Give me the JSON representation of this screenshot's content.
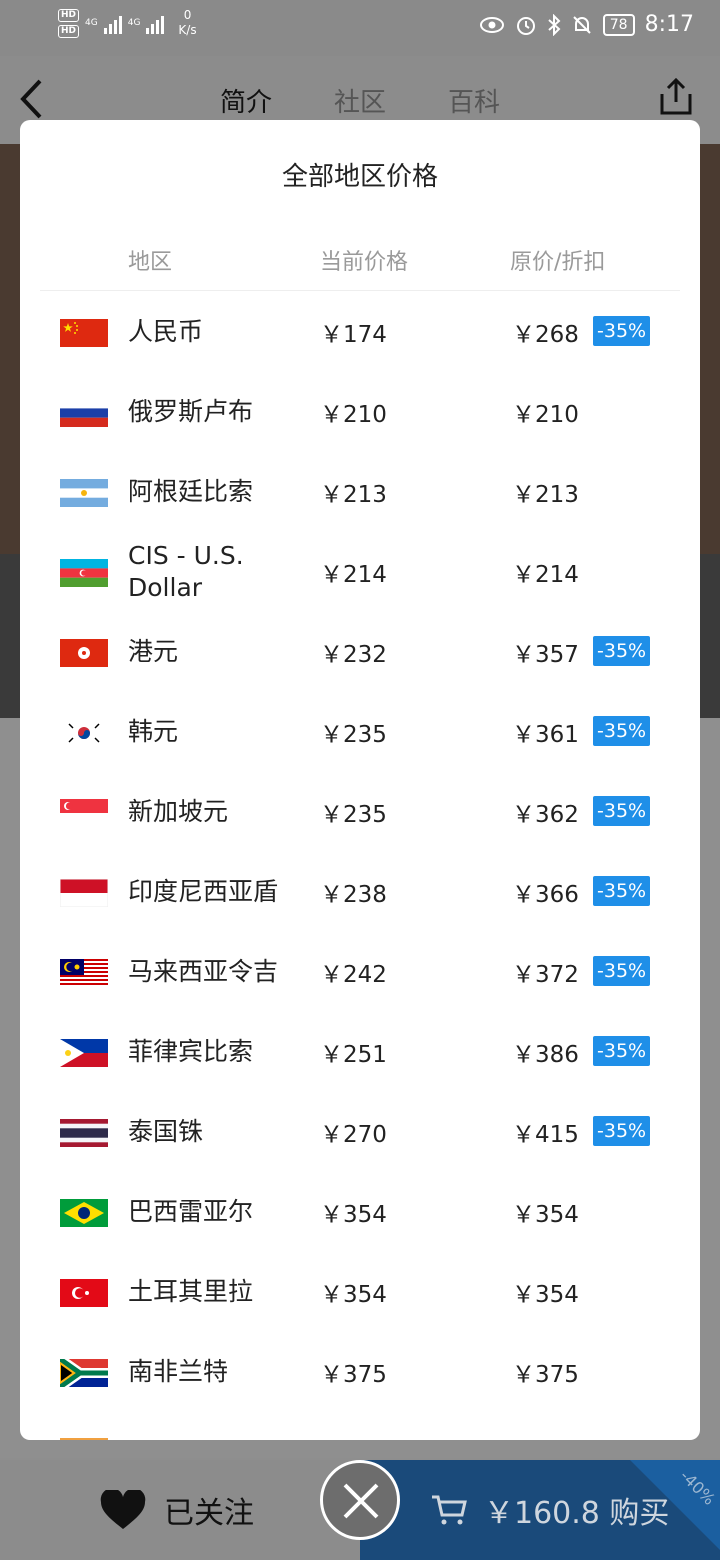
{
  "status_bar": {
    "speed_value": "0",
    "speed_unit": "K/s",
    "battery": "78",
    "time": "8:17",
    "signal1": "4G",
    "signal2": "4G"
  },
  "header": {
    "tabs": [
      "简介",
      "社区",
      "百科"
    ]
  },
  "modal": {
    "title": "全部地区价格",
    "columns": {
      "region": "地区",
      "current": "当前价格",
      "original": "原价/折扣"
    },
    "rows": [
      {
        "flag": "cn",
        "region": "人民币",
        "current": "￥174",
        "original": "￥268",
        "discount": "-35%"
      },
      {
        "flag": "ru",
        "region": "俄罗斯卢布",
        "current": "￥210",
        "original": "￥210",
        "discount": ""
      },
      {
        "flag": "ar",
        "region": "阿根廷比索",
        "current": "￥213",
        "original": "￥213",
        "discount": ""
      },
      {
        "flag": "az",
        "region": "CIS - U.S. Dollar",
        "current": "￥214",
        "original": "￥214",
        "discount": ""
      },
      {
        "flag": "hk",
        "region": "港元",
        "current": "￥232",
        "original": "￥357",
        "discount": "-35%"
      },
      {
        "flag": "kr",
        "region": "韩元",
        "current": "￥235",
        "original": "￥361",
        "discount": "-35%"
      },
      {
        "flag": "sg",
        "region": "新加坡元",
        "current": "￥235",
        "original": "￥362",
        "discount": "-35%"
      },
      {
        "flag": "id",
        "region": "印度尼西亚盾",
        "current": "￥238",
        "original": "￥366",
        "discount": "-35%"
      },
      {
        "flag": "my",
        "region": "马来西亚令吉",
        "current": "￥242",
        "original": "￥372",
        "discount": "-35%"
      },
      {
        "flag": "ph",
        "region": "菲律宾比索",
        "current": "￥251",
        "original": "￥386",
        "discount": "-35%"
      },
      {
        "flag": "th",
        "region": "泰国铢",
        "current": "￥270",
        "original": "￥415",
        "discount": "-35%"
      },
      {
        "flag": "br",
        "region": "巴西雷亚尔",
        "current": "￥354",
        "original": "￥354",
        "discount": ""
      },
      {
        "flag": "tr",
        "region": "土耳其里拉",
        "current": "￥354",
        "original": "￥354",
        "discount": ""
      },
      {
        "flag": "za",
        "region": "南非兰特",
        "current": "￥375",
        "original": "￥375",
        "discount": ""
      }
    ]
  },
  "bottom_bar": {
    "follow_label": "已关注",
    "buy_label": "￥160.8 购买",
    "corner_badge": "-40%"
  }
}
